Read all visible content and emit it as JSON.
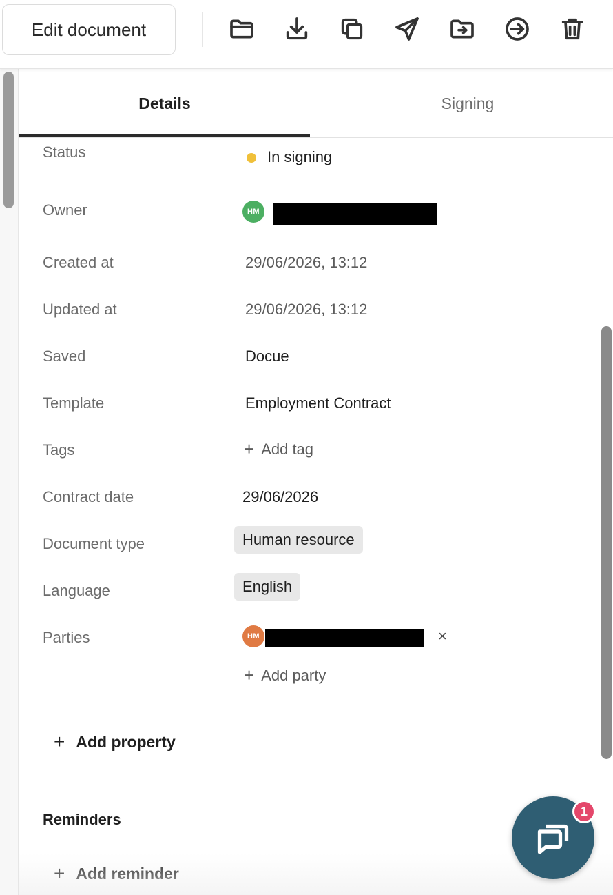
{
  "toolbar": {
    "edit_label": "Edit document",
    "icons": [
      "folder-icon",
      "download-icon",
      "copy-icon",
      "send-icon",
      "move-to-folder-icon",
      "sign-in-icon",
      "trash-icon"
    ]
  },
  "tabs": {
    "details": "Details",
    "signing": "Signing"
  },
  "details": {
    "status_label": "Status",
    "status_value": "In signing",
    "status_color": "#f0c03a",
    "owner_label": "Owner",
    "owner_initials": "HM",
    "owner_avatar_color": "#4caf62",
    "created_label": "Created at",
    "created_value": "29/06/2026, 13:12",
    "updated_label": "Updated at",
    "updated_value": "29/06/2026, 13:12",
    "saved_label": "Saved",
    "saved_value": "Docue",
    "template_label": "Template",
    "template_value": "Employment Contract",
    "tags_label": "Tags",
    "add_tag": "Add tag",
    "contract_date_label": "Contract date",
    "contract_date_value": "29/06/2026",
    "doc_type_label": "Document type",
    "doc_type_value": "Human resource",
    "language_label": "Language",
    "language_value": "English",
    "parties_label": "Parties",
    "party_initials": "HM",
    "party_avatar_color": "#e07a43",
    "remove_party": "×",
    "add_party": "Add party",
    "add_property": "Add property"
  },
  "reminders": {
    "title": "Reminders",
    "add_reminder": "Add reminder"
  },
  "chat": {
    "badge_count": "1",
    "button_color": "#2f5e73",
    "badge_color": "#e4476b"
  }
}
